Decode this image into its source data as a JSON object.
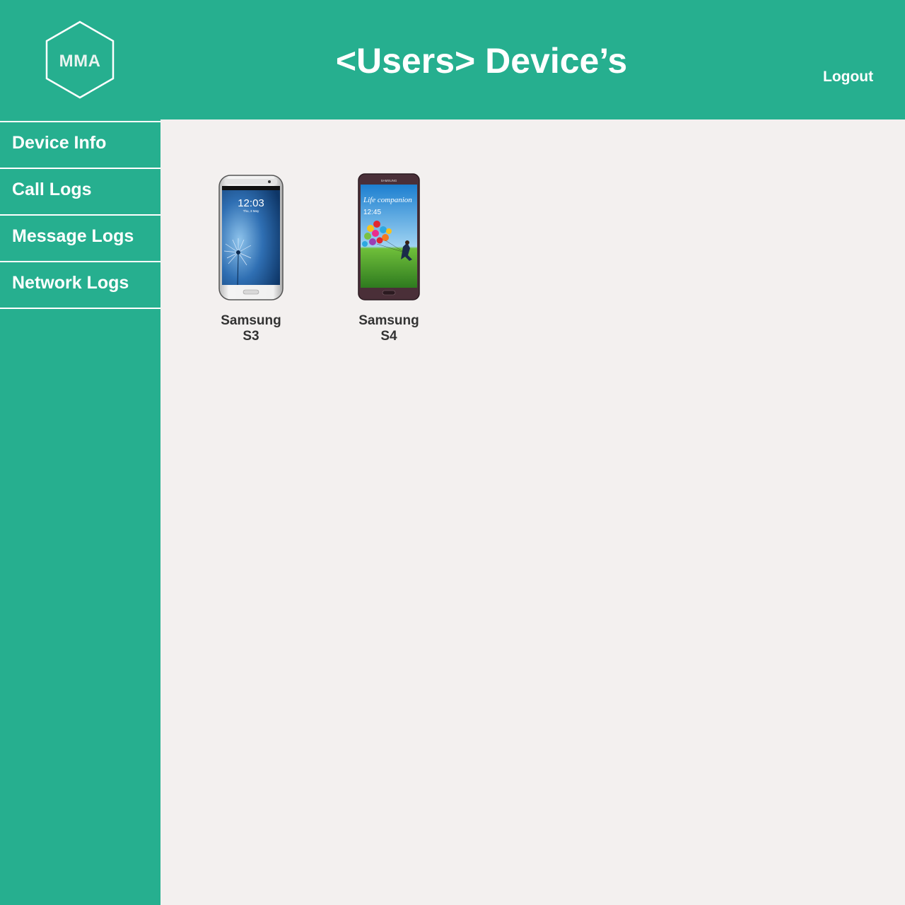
{
  "header": {
    "logo_text": "MMA",
    "title": "<Users> Device’s",
    "logout_label": "Logout"
  },
  "sidebar": {
    "items": [
      {
        "label": "Device Info"
      },
      {
        "label": "Call Logs"
      },
      {
        "label": "Message Logs"
      },
      {
        "label": "Network Logs"
      }
    ]
  },
  "devices": [
    {
      "brand": "Samsung",
      "model": "S3",
      "screen_time": "12:03",
      "screen_date": "Thu, 3 May",
      "color": "white"
    },
    {
      "brand": "Samsung",
      "model": "S4",
      "screen_time": "12:45",
      "screen_text": "Life companion",
      "color": "purple-brown"
    }
  ],
  "colors": {
    "accent": "#26af8f",
    "background": "#f3f0ef",
    "text_dark": "#333333"
  }
}
